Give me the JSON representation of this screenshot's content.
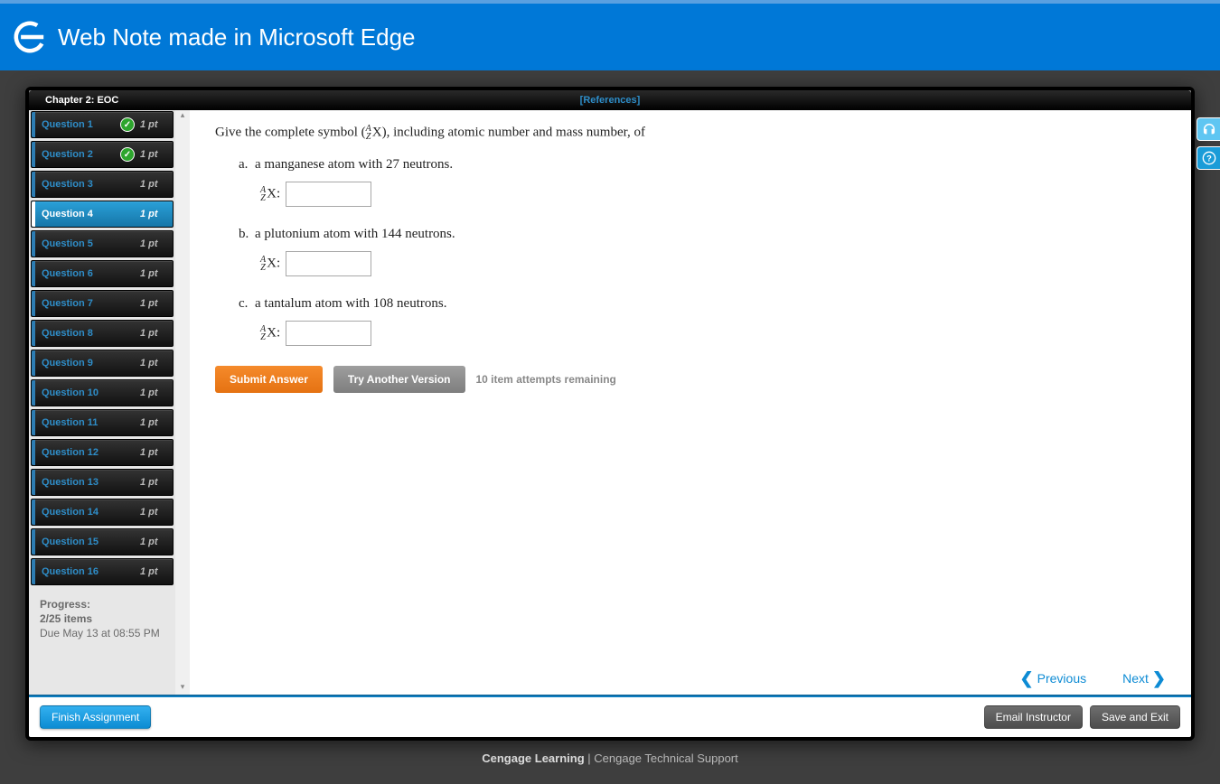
{
  "edge": {
    "title": "Web Note made in Microsoft Edge"
  },
  "chapter": {
    "label": "Chapter 2: EOC",
    "references": "[References]"
  },
  "questions": [
    {
      "label": "Question 1",
      "pts": "1 pt",
      "done": true,
      "active": false
    },
    {
      "label": "Question 2",
      "pts": "1 pt",
      "done": true,
      "active": false
    },
    {
      "label": "Question 3",
      "pts": "1 pt",
      "done": false,
      "active": false
    },
    {
      "label": "Question 4",
      "pts": "1 pt",
      "done": false,
      "active": true
    },
    {
      "label": "Question 5",
      "pts": "1 pt",
      "done": false,
      "active": false
    },
    {
      "label": "Question 6",
      "pts": "1 pt",
      "done": false,
      "active": false
    },
    {
      "label": "Question 7",
      "pts": "1 pt",
      "done": false,
      "active": false
    },
    {
      "label": "Question 8",
      "pts": "1 pt",
      "done": false,
      "active": false
    },
    {
      "label": "Question 9",
      "pts": "1 pt",
      "done": false,
      "active": false
    },
    {
      "label": "Question 10",
      "pts": "1 pt",
      "done": false,
      "active": false
    },
    {
      "label": "Question 11",
      "pts": "1 pt",
      "done": false,
      "active": false
    },
    {
      "label": "Question 12",
      "pts": "1 pt",
      "done": false,
      "active": false
    },
    {
      "label": "Question 13",
      "pts": "1 pt",
      "done": false,
      "active": false
    },
    {
      "label": "Question 14",
      "pts": "1 pt",
      "done": false,
      "active": false
    },
    {
      "label": "Question 15",
      "pts": "1 pt",
      "done": false,
      "active": false
    },
    {
      "label": "Question 16",
      "pts": "1 pt",
      "done": false,
      "active": false
    }
  ],
  "progress": {
    "label": "Progress:",
    "items": "2/25 items",
    "due": "Due May 13 at 08:55 PM"
  },
  "question": {
    "prompt_pre": "Give the complete symbol (",
    "prompt_post": "X), including atomic number and mass number, of",
    "parts": {
      "a": "a manganese atom with 27 neutrons.",
      "b": "a plutonium atom with 144 neutrons.",
      "c": "a tantalum atom with 108 neutrons."
    },
    "input_label": "X:"
  },
  "actions": {
    "submit": "Submit Answer",
    "try_another": "Try Another Version",
    "remaining": "10 item attempts remaining",
    "previous": "Previous",
    "next": "Next"
  },
  "footer": {
    "finish": "Finish Assignment",
    "email": "Email Instructor",
    "save_exit": "Save and Exit"
  },
  "cengage": {
    "brand": "Cengage Learning",
    "sep": " | ",
    "support": "Cengage Technical Support"
  }
}
